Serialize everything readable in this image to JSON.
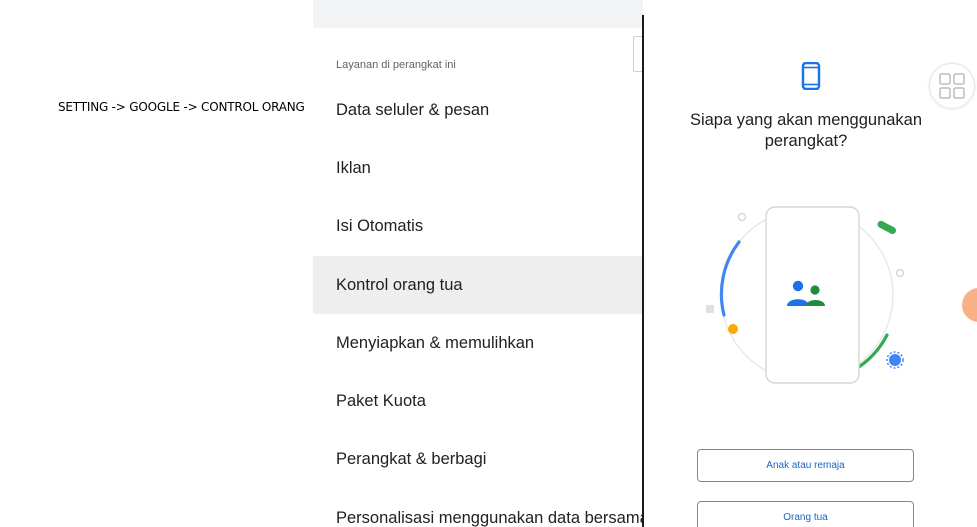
{
  "caption": "SETTING -> GOOGLE -> CONTROL ORANG",
  "settings": {
    "section_header": "Layanan di perangkat ini",
    "items": [
      {
        "label": "Data seluler & pesan"
      },
      {
        "label": "Iklan"
      },
      {
        "label": "Isi Otomatis"
      },
      {
        "label": "Kontrol orang tua",
        "selected": true
      },
      {
        "label": "Menyiapkan & memulihkan"
      },
      {
        "label": "Paket Kuota"
      },
      {
        "label": "Perangkat & berbagi"
      },
      {
        "label": "Personalisasi menggunakan data bersama"
      }
    ]
  },
  "setup": {
    "question": "Siapa yang akan menggunakan perangkat?",
    "option_child": "Anak atau remaja",
    "option_parent": "Orang tua"
  },
  "colors": {
    "accent_blue": "#1a73e8",
    "green": "#1e8e3e",
    "yellow": "#f9ab00",
    "button_border": "#5f8fc9"
  },
  "icons": [
    "phone-icon",
    "grid-icon",
    "family-icon"
  ]
}
